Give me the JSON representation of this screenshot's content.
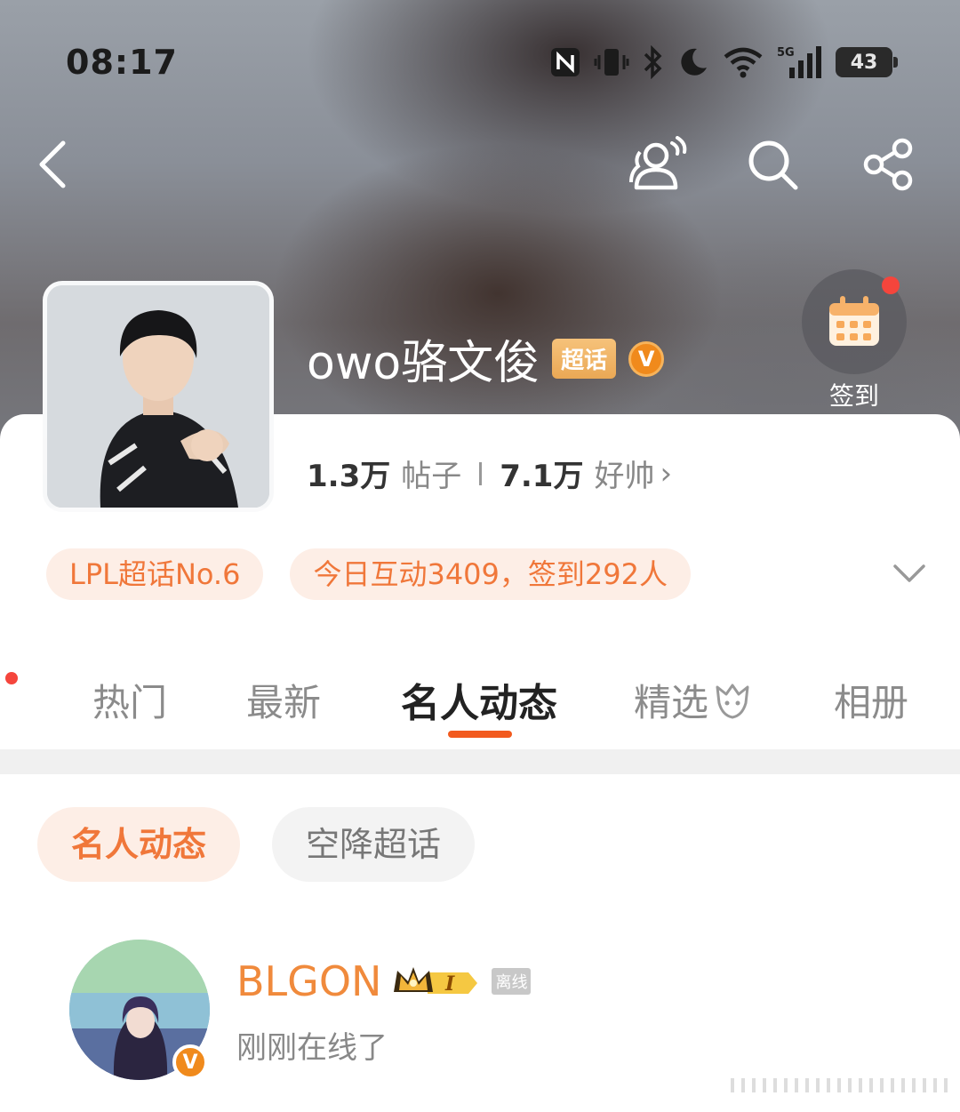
{
  "status_bar": {
    "time": "08:17",
    "network": "5G",
    "battery": "43"
  },
  "topic": {
    "title": "owo骆文俊",
    "tag": "超话",
    "verified_badge": "V",
    "checkin_label": "签到"
  },
  "stats": {
    "posts_count": "1.3万",
    "posts_label": "帖子",
    "fans_count": "7.1万",
    "fans_label": "好帅",
    "chevron": "›"
  },
  "pills": [
    "LPL超话No.6",
    "今日互动3409，签到292人"
  ],
  "tabs": [
    "热门",
    "最新",
    "名人动态",
    "精选",
    "相册"
  ],
  "active_tab": "名人动态",
  "subtabs": [
    "名人动态",
    "空降超话"
  ],
  "user": {
    "name": "BLGON",
    "rank": "I",
    "offline_tag": "离线",
    "status": "刚刚在线了",
    "verified_badge": "V"
  },
  "colors": {
    "accent": "#f25a1e",
    "pill_bg": "#fdeee6",
    "pill_text": "#f0773a",
    "username": "#f08a3c",
    "badge_orange": "#f08a1c"
  },
  "icons": {
    "back": "back-icon",
    "super_topic_friends": "group-chat-icon",
    "search": "search-icon",
    "share": "share-icon",
    "calendar": "calendar-icon",
    "expand": "chevron-down-icon"
  }
}
